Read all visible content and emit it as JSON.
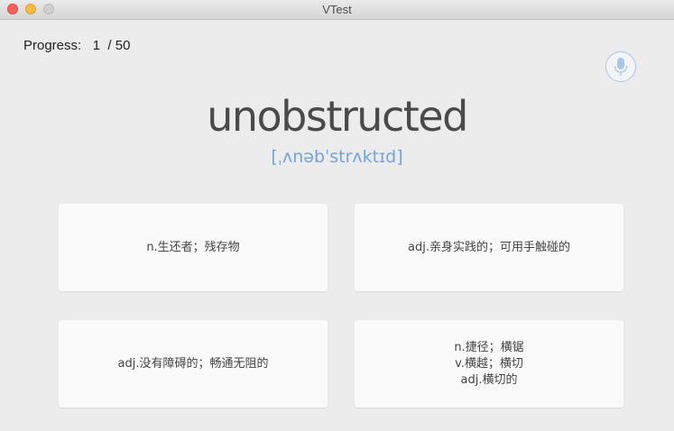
{
  "window": {
    "title": "VTest"
  },
  "progress": {
    "label": "Progress:",
    "current": "1",
    "separator": "/",
    "total": "50"
  },
  "mic": {
    "icon": "microphone-icon",
    "accent_color": "#a9c6ea"
  },
  "word": {
    "text": "unobstructed",
    "phonetic": "[ˌʌnəbˈstrʌktɪd]",
    "phonetic_color": "#74a3e4"
  },
  "options": [
    {
      "text": "n.生还者；残存物"
    },
    {
      "text": "adj.亲身实践的；可用手触碰的"
    },
    {
      "text": "adj.没有障碍的；畅通无阻的"
    },
    {
      "text": "n.捷径；横锯\nv.横越；横切\nadj.横切的"
    }
  ]
}
